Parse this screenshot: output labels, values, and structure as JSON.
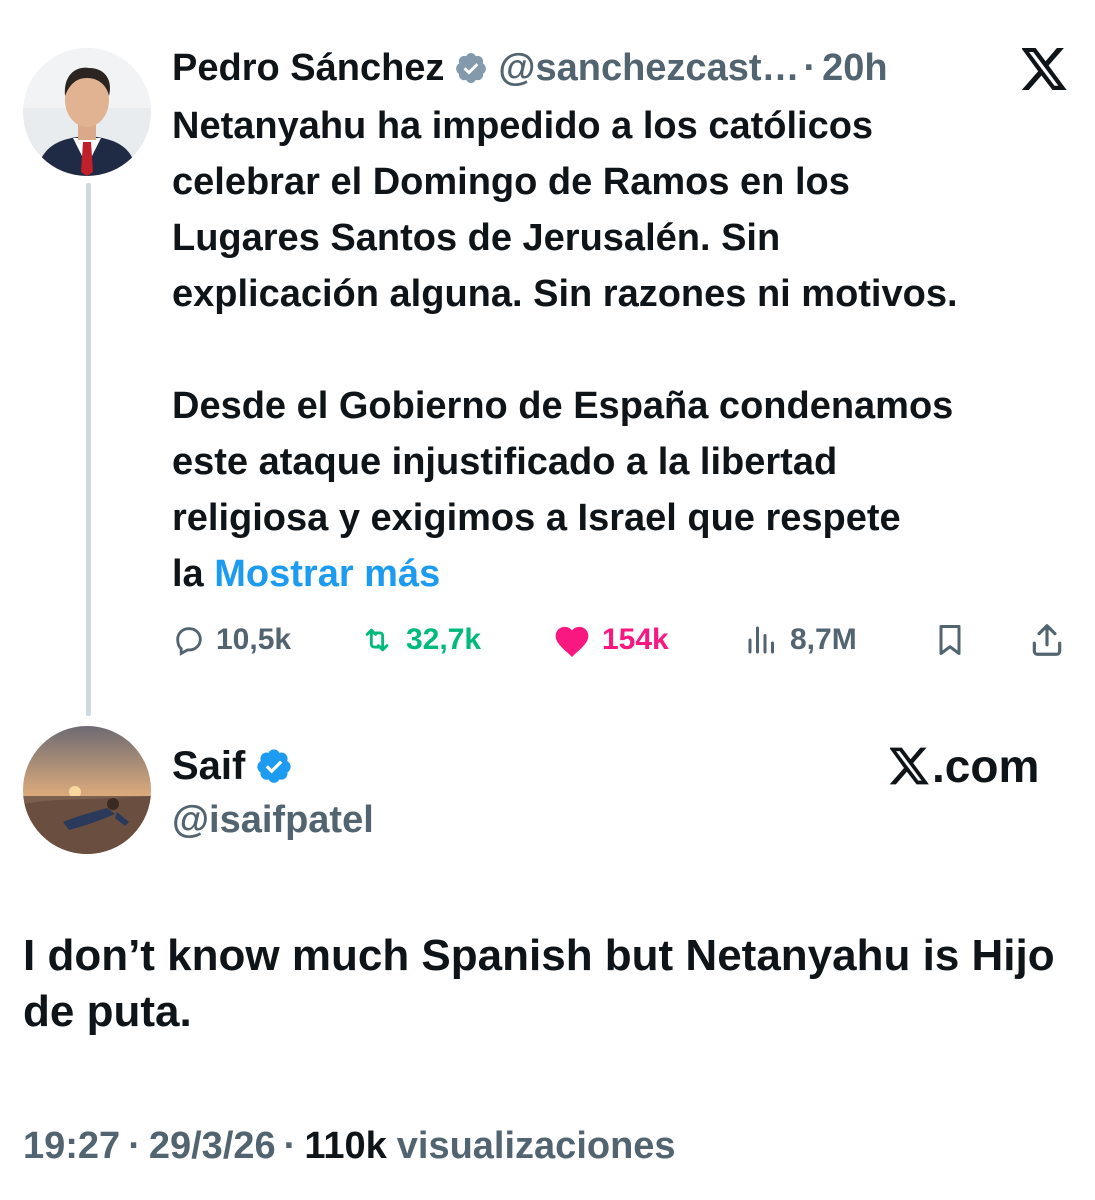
{
  "original_post": {
    "author_name": "Pedro Sánchez",
    "verified": true,
    "handle": "@sanchezcast…",
    "separator": "·",
    "time": "20h",
    "text_lines_p1": [
      "Netanyahu ha impedido a los católicos",
      "celebrar el Domingo de Ramos en los",
      "Lugares Santos de Jerusalén. Sin",
      "explicación alguna. Sin razones ni motivos."
    ],
    "text_lines_p2": [
      "Desde el Gobierno de España condenamos",
      "este ataque injustificado a la libertad",
      "religiosa y exigimos a Israel que respete"
    ],
    "last_line_prefix": "la ",
    "show_more_label": "Mostrar más",
    "stats": {
      "replies": "10,5k",
      "reposts": "32,7k",
      "likes": "154k",
      "views": "8,7M"
    },
    "icons": {
      "platform": "x-logo-icon",
      "verified": "verified-badge-icon",
      "reply": "reply-icon",
      "repost": "repost-icon",
      "like": "heart-icon",
      "views": "views-chart-icon",
      "bookmark": "bookmark-icon",
      "share": "share-icon"
    }
  },
  "reply_post": {
    "author_name": "Saif",
    "verified": true,
    "handle": "@isaifpatel",
    "watermark": ".com",
    "text": "I don’t know much Spanish but  Netanyahu is Hijo de puta.",
    "timestamp": "19:27",
    "separator": "·",
    "date": "29/3/26",
    "views_count": "110k",
    "views_label": "visualizaciones"
  },
  "colors": {
    "text": "#0f1419",
    "secondary": "#536471",
    "accent_blue": "#1d9bf0",
    "repost_green": "#00ba7c",
    "like_pink": "#f91880",
    "thread_line": "#cfd9de"
  }
}
